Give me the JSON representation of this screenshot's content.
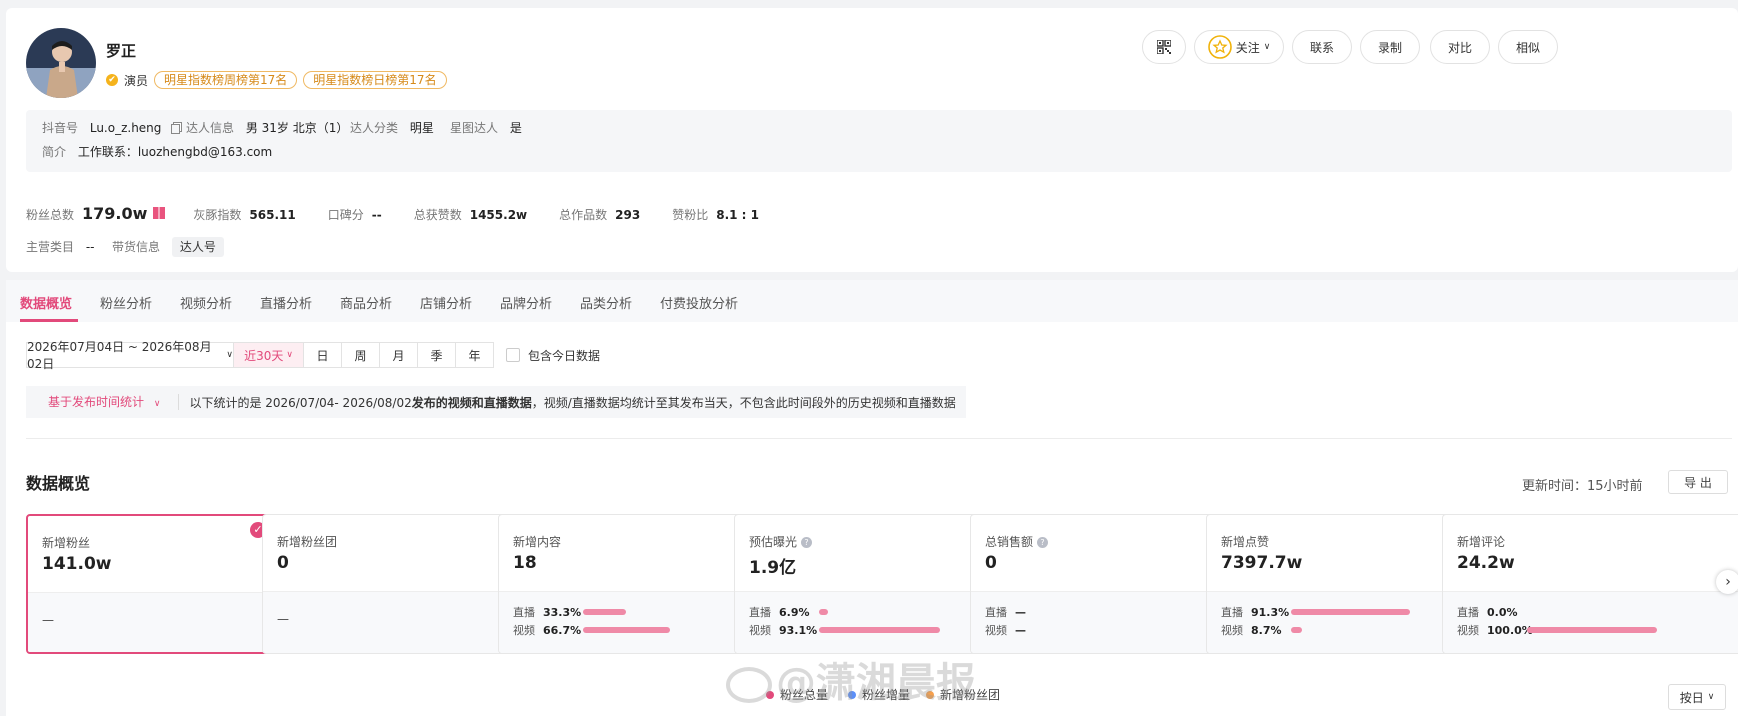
{
  "profile": {
    "name": "罗正",
    "role": "演员",
    "badges": [
      "明星指数榜周榜第17名",
      "明星指数榜日榜第17名"
    ],
    "actions": {
      "follow": "关注",
      "contact": "联系",
      "record": "录制",
      "compare": "对比",
      "similar": "相似"
    },
    "info": {
      "douyin_k": "抖音号",
      "douyin_v": "Lu.o_z.heng",
      "talent_k": "达人信息",
      "talent_v": "男 31岁 北京（1）",
      "cat_k": "达人分类",
      "cat_v": "明星",
      "star_k": "星图达人",
      "star_v": "是",
      "intro_k": "简介",
      "intro_v": "工作联系：luozhengbd@163.com"
    },
    "stats": {
      "fans_k": "粉丝总数",
      "fans_v": "179.0w",
      "index_k": "灰豚指数",
      "index_v": "565.11",
      "rep_k": "口碑分",
      "rep_v": "--",
      "likes_k": "总获赞数",
      "likes_v": "1455.2w",
      "works_k": "总作品数",
      "works_v": "293",
      "ratio_k": "赞粉比",
      "ratio_v": "8.1 : 1"
    },
    "meta": {
      "main_k": "主营类目",
      "main_v": "--",
      "goods_k": "带货信息",
      "goods_v": "达人号"
    }
  },
  "tabs": [
    "数据概览",
    "粉丝分析",
    "视频分析",
    "直播分析",
    "商品分析",
    "店铺分析",
    "品牌分析",
    "品类分析",
    "付费投放分析"
  ],
  "filter": {
    "date_range": "2026年07月04日 ~ 2026年08月02日",
    "recent": "近30天",
    "periods": [
      "日",
      "周",
      "月",
      "季",
      "年"
    ],
    "include_today": "包含今日数据"
  },
  "note": {
    "basis": "基于发布时间统计",
    "prefix": "以下统计的是 2026/07/04- 2026/08/02 ",
    "bold": "发布的视频和直播数据",
    "suffix": "，视频/直播数据均统计至其发布当天，不包含此时间段外的历史视频和直播数据"
  },
  "overview": {
    "title": "数据概览",
    "update": "更新时间：15小时前",
    "export": "导 出",
    "cards": [
      {
        "label": "新增粉丝",
        "value": "141.0w",
        "dash": "—"
      },
      {
        "label": "新增粉丝团",
        "value": "0",
        "dash": "—"
      },
      {
        "label": "新增内容",
        "value": "18",
        "live_k": "直播",
        "live_v": "33.3%",
        "live_p": 0.333,
        "video_k": "视频",
        "video_v": "66.7%",
        "video_p": 0.667
      },
      {
        "label": "预估曝光",
        "value": "1.9亿",
        "live_k": "直播",
        "live_v": "6.9%",
        "live_p": 0.069,
        "video_k": "视频",
        "video_v": "93.1%",
        "video_p": 0.931
      },
      {
        "label": "总销售额",
        "value": "0",
        "live_k": "直播",
        "live_v": "—",
        "video_k": "视频",
        "video_v": "—"
      },
      {
        "label": "新增点赞",
        "value": "7397.7w",
        "live_k": "直播",
        "live_v": "91.3%",
        "live_p": 0.913,
        "video_k": "视频",
        "video_v": "8.7%",
        "video_p": 0.087
      },
      {
        "label": "新增评论",
        "value": "24.2w",
        "live_k": "直播",
        "live_v": "0.0%",
        "live_p": 0,
        "video_k": "视频",
        "video_v": "100.0%",
        "video_p": 1.0
      }
    ]
  },
  "legend": [
    "粉丝总量",
    "粉丝增量",
    "新增粉丝团"
  ],
  "legend_colors": [
    "#e24a7b",
    "#5b8ff9",
    "#f6a04d"
  ],
  "by_day": "按日",
  "watermark": "@潇湘晨报",
  "colors": {
    "accent": "#e24a7b",
    "bar": "#ef8aa7"
  }
}
